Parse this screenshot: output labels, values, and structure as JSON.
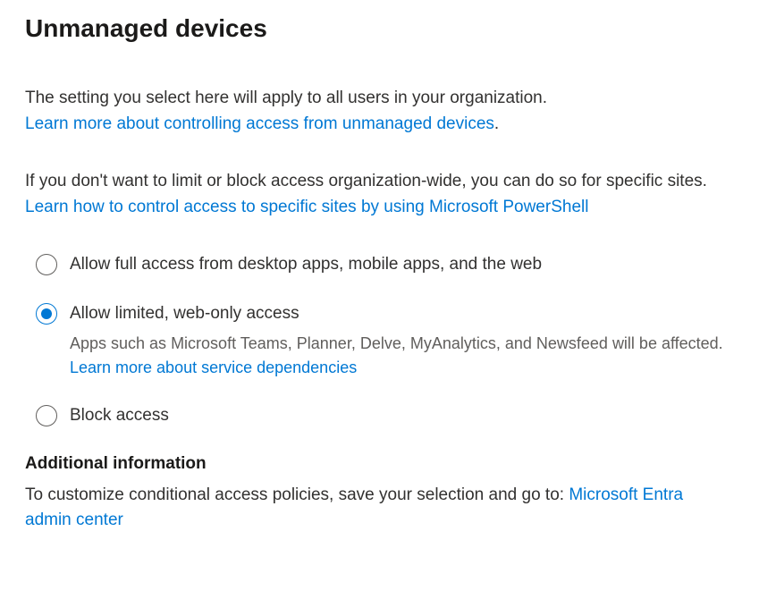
{
  "heading": "Unmanaged devices",
  "intro1": {
    "text": "The setting you select here will apply to all users in your organization.",
    "link": "Learn more about controlling access from unmanaged devices",
    "linkSuffix": "."
  },
  "intro2": {
    "text": "If you don't want to limit or block access organization-wide, you can do so for specific sites.",
    "link": "Learn how to control access to specific sites by using Microsoft PowerShell"
  },
  "options": {
    "fullAccess": {
      "label": "Allow full access from desktop apps, mobile apps, and the web",
      "selected": false
    },
    "limitedAccess": {
      "label": "Allow limited, web-only access",
      "desc": "Apps such as Microsoft Teams, Planner, Delve, MyAnalytics, and Newsfeed will be affected. ",
      "descLink": "Learn more about service dependencies",
      "selected": true
    },
    "blockAccess": {
      "label": "Block access",
      "selected": false
    }
  },
  "additional": {
    "heading": "Additional information",
    "text": "To customize conditional access policies, save your selection and go to: ",
    "link": "Microsoft Entra admin center"
  }
}
